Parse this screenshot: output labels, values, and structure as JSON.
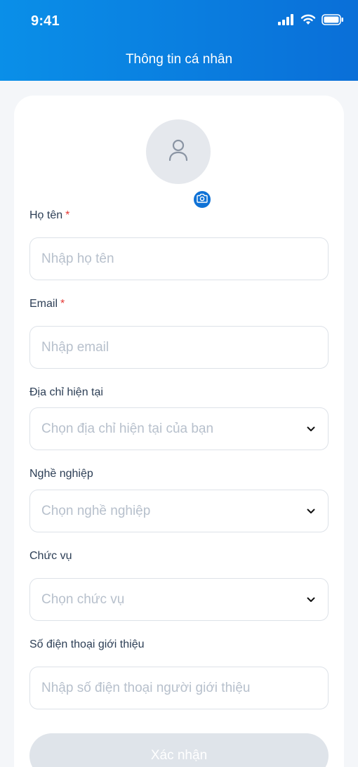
{
  "status_bar": {
    "time": "9:41"
  },
  "header": {
    "title": "Thông tin cá nhân"
  },
  "form": {
    "full_name": {
      "label": "Họ tên",
      "required_mark": "*",
      "placeholder": "Nhập họ tên",
      "value": ""
    },
    "email": {
      "label": "Email",
      "required_mark": "*",
      "placeholder": "Nhập email",
      "value": ""
    },
    "address": {
      "label": "Địa chỉ hiện tại",
      "placeholder": "Chọn địa chỉ hiện tại của bạn"
    },
    "occupation": {
      "label": "Nghề nghiệp",
      "placeholder": "Chọn nghề nghiệp"
    },
    "position": {
      "label": "Chức vụ",
      "placeholder": "Chọn chức vụ"
    },
    "referral_phone": {
      "label": "Số điện thoại giới thiệu",
      "placeholder": "Nhập số điện thoại người giới thiệu",
      "value": ""
    },
    "submit_label": "Xác nhận"
  },
  "icons": {
    "avatar": "user-icon",
    "camera": "camera-icon",
    "dropdown": "chevron-down-icon",
    "signal": "signal-icon",
    "wifi": "wifi-icon",
    "battery": "battery-icon"
  },
  "colors": {
    "header_start": "#0a8fe8",
    "header_end": "#0a6fd8",
    "accent": "#0f72d6",
    "required": "#e53935",
    "button_disabled": "#dfe4ea"
  }
}
